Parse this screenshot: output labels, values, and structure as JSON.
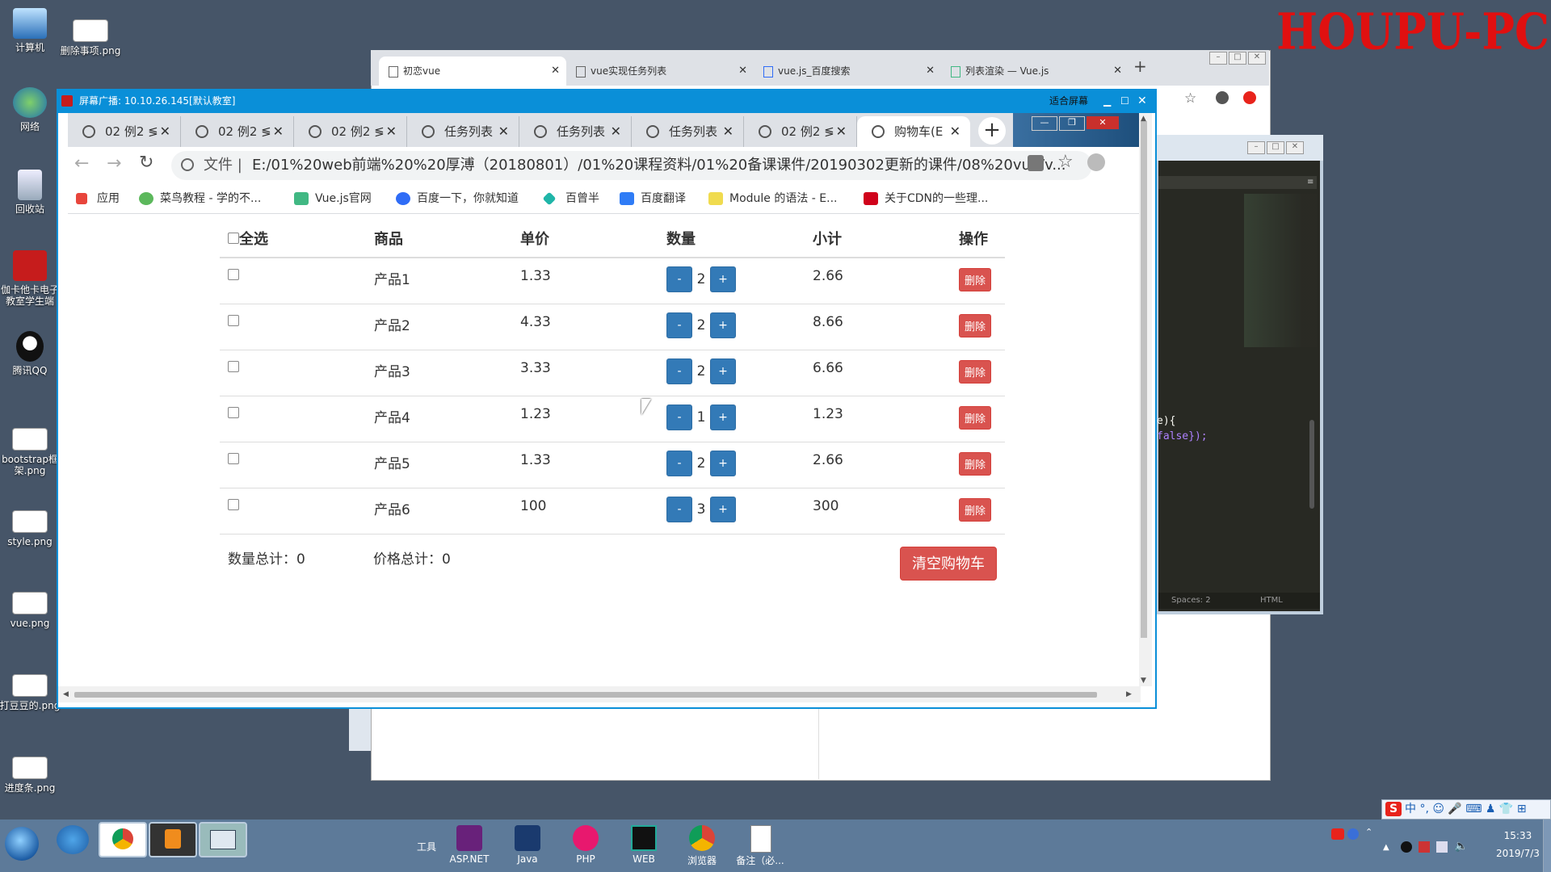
{
  "desktop": {
    "watermark": "HOUPU-PC",
    "icons": [
      {
        "label": "计算机"
      },
      {
        "label": "删除事项.png"
      },
      {
        "label": "网络"
      },
      {
        "label": "回收站"
      },
      {
        "label": "伽卡他卡电子教室学生端"
      },
      {
        "label": "腾讯QQ"
      },
      {
        "label": "bootstrap框架.png"
      },
      {
        "label": "style.png"
      },
      {
        "label": "vue.png"
      },
      {
        "label": "打豆豆的.png"
      },
      {
        "label": "进度条.png"
      }
    ]
  },
  "back_browser": {
    "tabs": [
      {
        "label": "初恋vue"
      },
      {
        "label": "vue实现任务列表"
      },
      {
        "label": "vue.js_百度搜索"
      },
      {
        "label": "列表渲染 — Vue.js"
      }
    ],
    "new_tab": "+"
  },
  "editor": {
    "code_line1": "e){",
    "code_line2": "false});",
    "status_spaces": "Spaces: 2",
    "status_lang": "HTML"
  },
  "broadcast": {
    "title": "屏幕广播: 10.10.26.145[默认教室]",
    "fit_label": "适合屏幕"
  },
  "browser": {
    "tabs": [
      {
        "label": "02 例2 ≶"
      },
      {
        "label": "02 例2 ≶"
      },
      {
        "label": "02 例2 ≶"
      },
      {
        "label": "任务列表"
      },
      {
        "label": "任务列表"
      },
      {
        "label": "任务列表"
      },
      {
        "label": "02 例2 ≶"
      },
      {
        "label": "购物车(E"
      }
    ],
    "new_tab": "+",
    "url_prefix": "文件 |",
    "url": "E:/01%20web前端%20%20厚溥（20180801）/01%20课程资料/01%20备课课件/20190302更新的课件/08%20vue/v...",
    "bookmarks": [
      {
        "label": "应用",
        "color": "#e8453c"
      },
      {
        "label": "菜鸟教程 - 学的不...",
        "color": "#5cb85c"
      },
      {
        "label": "Vue.js官网",
        "color": "#41b883"
      },
      {
        "label": "百度一下，你就知道",
        "color": "#2f6cf6"
      },
      {
        "label": "百曾半",
        "color": "#1fb5a8"
      },
      {
        "label": "百度翻译",
        "color": "#2f7cf6"
      },
      {
        "label": "Module 的语法 - E...",
        "color": "#f0db4f"
      },
      {
        "label": "关于CDN的一些理...",
        "color": "#d0021b"
      }
    ]
  },
  "cart": {
    "headers": {
      "select_all": "全选",
      "product": "商品",
      "price": "单价",
      "qty": "数量",
      "subtotal": "小计",
      "ops": "操作"
    },
    "rows": [
      {
        "name": "产品1",
        "price": "1.33",
        "qty": "2",
        "subtotal": "2.66",
        "minus": "-",
        "plus": "+",
        "delete": "删除"
      },
      {
        "name": "产品2",
        "price": "4.33",
        "qty": "2",
        "subtotal": "8.66",
        "minus": "-",
        "plus": "+",
        "delete": "删除"
      },
      {
        "name": "产品3",
        "price": "3.33",
        "qty": "2",
        "subtotal": "6.66",
        "minus": "-",
        "plus": "+",
        "delete": "删除"
      },
      {
        "name": "产品4",
        "price": "1.23",
        "qty": "1",
        "subtotal": "1.23",
        "minus": "-",
        "plus": "+",
        "delete": "删除"
      },
      {
        "name": "产品5",
        "price": "1.33",
        "qty": "2",
        "subtotal": "2.66",
        "minus": "-",
        "plus": "+",
        "delete": "删除"
      },
      {
        "name": "产品6",
        "price": "100",
        "qty": "3",
        "subtotal": "300",
        "minus": "-",
        "plus": "+",
        "delete": "删除"
      }
    ],
    "qty_total": "数量总计：0",
    "price_total": "价格总计：0",
    "clear_button": "清空购物车"
  },
  "taskbar": {
    "tools_label": "工具",
    "apps": [
      {
        "label": "ASP.NET"
      },
      {
        "label": "Java"
      },
      {
        "label": "PHP"
      },
      {
        "label": "WEB"
      },
      {
        "label": "浏览器"
      },
      {
        "label": "备注（必..."
      }
    ],
    "time": "15:33",
    "date": "2019/7/3",
    "ime_text": "中 °, ☺ 🎤 ⌨ ♟ 👕 ⊞"
  },
  "colors": {
    "accent_blue": "#337ab7",
    "danger_red": "#d9534f",
    "broadcast_bar": "#0a8fd8",
    "desktop_bg": "#465568"
  }
}
